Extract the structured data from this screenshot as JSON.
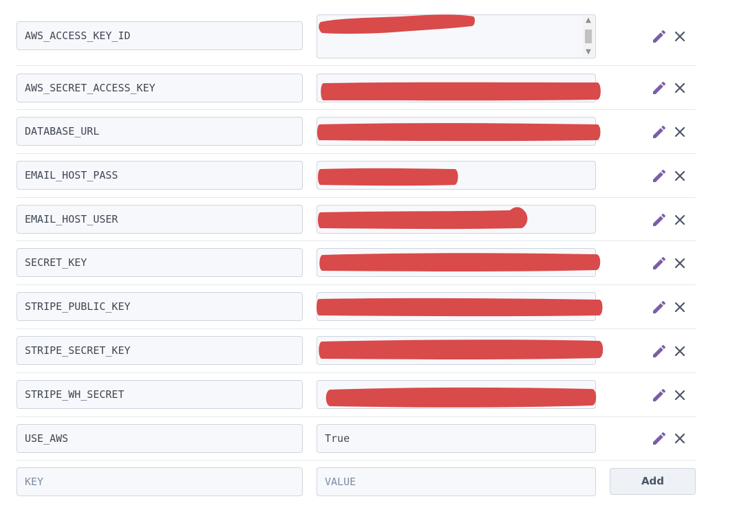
{
  "config_vars": [
    {
      "key": "AWS_ACCESS_KEY_ID",
      "value": "",
      "redacted": true
    },
    {
      "key": "AWS_SECRET_ACCESS_KEY",
      "value": "",
      "redacted": true
    },
    {
      "key": "DATABASE_URL",
      "value": "",
      "redacted": true
    },
    {
      "key": "EMAIL_HOST_PASS",
      "value": "",
      "redacted": true
    },
    {
      "key": "EMAIL_HOST_USER",
      "value": "",
      "redacted": true
    },
    {
      "key": "SECRET_KEY",
      "value": "",
      "redacted": true
    },
    {
      "key": "STRIPE_PUBLIC_KEY",
      "value": "",
      "redacted": true
    },
    {
      "key": "STRIPE_SECRET_KEY",
      "value": "",
      "redacted": true
    },
    {
      "key": "STRIPE_WH_SECRET",
      "value": "",
      "redacted": true
    },
    {
      "key": "USE_AWS",
      "value": "True",
      "redacted": false
    }
  ],
  "new_var": {
    "key_placeholder": "KEY",
    "value_placeholder": "VALUE",
    "add_label": "Add"
  },
  "icons": {
    "edit": "pencil-icon",
    "delete": "close-icon"
  },
  "colors": {
    "edit_icon": "#7b5ea7",
    "delete_icon": "#4b5566",
    "redaction": "#d94a4a"
  }
}
